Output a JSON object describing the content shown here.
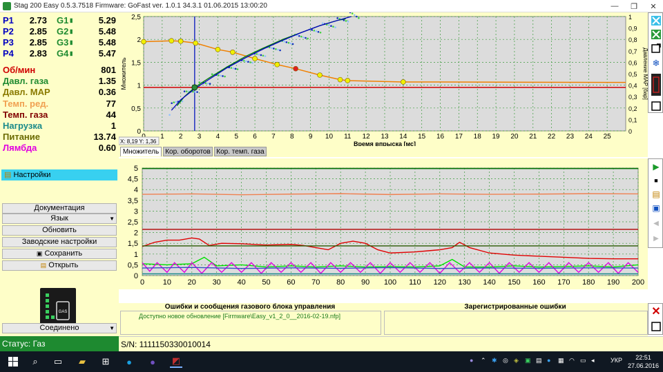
{
  "window": {
    "title": "Stag 200 Easy 0.5.3.7518 Firmware: GoFast  ver. 1.0.1  34.3.1  01.06.2015 13:00:20",
    "minimize": "—",
    "restore": "❐",
    "close": "✕"
  },
  "params": {
    "pressures": [
      {
        "p_label": "P1",
        "p_value": "2.73",
        "g_label": "G1",
        "g_value": "5.29"
      },
      {
        "p_label": "P2",
        "p_value": "2.85",
        "g_label": "G2",
        "g_value": "5.48"
      },
      {
        "p_label": "P3",
        "p_value": "2.85",
        "g_label": "G3",
        "g_value": "5.48"
      },
      {
        "p_label": "P4",
        "p_value": "2.83",
        "g_label": "G4",
        "g_value": "5.47"
      }
    ],
    "readings": [
      {
        "label": "Об/мин",
        "value": "801",
        "color": "#d00000"
      },
      {
        "label": "Давл. газа",
        "value": "1.35",
        "color": "#1e8a30"
      },
      {
        "label": "Давл. MAP",
        "value": "0.36",
        "color": "#8a7a00"
      },
      {
        "label": "Темп. ред.",
        "value": "77",
        "color": "#f0a050"
      },
      {
        "label": "Темп. газа",
        "value": "44",
        "color": "#800000"
      },
      {
        "label": "Нагрузка",
        "value": "1",
        "color": "#1a8a8a"
      },
      {
        "label": "Питание",
        "value": "13.74",
        "color": "#6a6a00"
      },
      {
        "label": "Лямбда",
        "value": "0.60",
        "color": "#e000e0"
      }
    ]
  },
  "settings": {
    "header": "Настройки",
    "buttons": {
      "docs": "Документация",
      "language": "Язык",
      "update": "Обновить",
      "factory": "Заводские настройки",
      "save": "Сохранить",
      "open": "Открыть",
      "connected": "Соединено"
    }
  },
  "gas_icon_label": "GAS",
  "status": {
    "left": "Статус: Газ",
    "serial": "S/N: 1111150330010014"
  },
  "chart1": {
    "ylabel_left": "Множитель",
    "ylabel_right": "Давление MAP [бар]",
    "xlabel": "Время впрыска [мс]",
    "cursor_readout": "X: 8,19  Y: 1,36"
  },
  "tabs": [
    "Множитель",
    "Кор. оборотов",
    "Кор. темп. газа"
  ],
  "errors": {
    "left_header": "Ошибки и сообщения газового блока управления",
    "right_header": "Зарегистрированные ошибки",
    "message": "Доступно новое обновление [Firmware\\Easy_v1_2_0__2016-02-19.nfp]"
  },
  "taskbar": {
    "lang": "УКР",
    "time": "22:51",
    "date": "27.06.2016"
  },
  "chart_data": [
    {
      "type": "line",
      "title": "",
      "xlabel": "Время впрыска [мс]",
      "ylabel": "Множитель",
      "y2label": "Давление MAP [бар]",
      "xlim": [
        0,
        26
      ],
      "ylim": [
        0,
        2.5
      ],
      "y2lim": [
        0,
        1.0
      ],
      "xticks": [
        0,
        1,
        2,
        3,
        4,
        5,
        6,
        7,
        8,
        9,
        10,
        11,
        12,
        13,
        14,
        15,
        16,
        17,
        18,
        19,
        20,
        21,
        22,
        23,
        24,
        25
      ],
      "yticks": [
        0,
        0.5,
        1,
        1.5,
        2,
        2.5
      ],
      "y2ticks": [
        0,
        0.1,
        0.2,
        0.3,
        0.4,
        0.5,
        0.6,
        0.7,
        0.8,
        0.9,
        1
      ],
      "grid": true,
      "cursor_x": 2.75,
      "reference_y": 0.95,
      "series": [
        {
          "color": "#f08000",
          "axis": "left",
          "x": [
            0,
            1.5,
            2,
            2.8,
            4,
            4.8,
            6,
            7.2,
            8.2,
            9.5,
            10.6,
            11,
            14,
            26
          ],
          "y": [
            1.95,
            1.97,
            1.96,
            1.92,
            1.78,
            1.72,
            1.58,
            1.45,
            1.36,
            1.22,
            1.12,
            1.1,
            1.07,
            1.06
          ]
        },
        {
          "color": "#008000",
          "axis": "left",
          "x": [
            1.8,
            2.2,
            2.75,
            3.5,
            4.5,
            5.5,
            6.5,
            7.5,
            8.5,
            9.5,
            10.5,
            10.9
          ],
          "y": [
            0.55,
            0.75,
            0.95,
            1.15,
            1.4,
            1.63,
            1.82,
            2.0,
            2.15,
            2.3,
            2.42,
            2.45
          ]
        },
        {
          "color": "#0000c0",
          "axis": "left",
          "x": [
            1.5,
            2.0,
            2.75,
            3.5,
            4.5,
            5.5,
            6.5,
            7.5,
            8.5,
            9.5,
            10.5,
            11.2
          ],
          "y": [
            0.45,
            0.68,
            0.92,
            1.12,
            1.38,
            1.6,
            1.8,
            1.98,
            2.15,
            2.3,
            2.42,
            2.5
          ]
        }
      ]
    },
    {
      "type": "line",
      "title": "",
      "xlabel": "",
      "ylabel": "",
      "xlim": [
        0,
        200
      ],
      "ylim": [
        0,
        5
      ],
      "xticks": [
        0,
        10,
        20,
        30,
        40,
        50,
        60,
        70,
        80,
        90,
        100,
        110,
        120,
        130,
        140,
        150,
        160,
        170,
        180,
        190,
        200
      ],
      "yticks": [
        0,
        0.5,
        1,
        1.5,
        2,
        2.5,
        3,
        3.5,
        4,
        4.5,
        5
      ],
      "grid": true,
      "series": [
        {
          "color": "#007000",
          "x": [
            0,
            200
          ],
          "y": [
            4.98,
            4.98
          ]
        },
        {
          "color": "#f08050",
          "x": [
            0,
            20,
            40,
            60,
            80,
            100,
            120,
            140,
            160,
            180,
            200
          ],
          "y": [
            3.78,
            3.8,
            3.76,
            3.79,
            3.81,
            3.77,
            3.8,
            3.78,
            3.79,
            3.81,
            3.8
          ]
        },
        {
          "color": "#b00000",
          "x": [
            0,
            200
          ],
          "y": [
            2.15,
            2.15
          ]
        },
        {
          "color": "#e00000",
          "x": [
            0,
            5,
            10,
            15,
            20,
            23,
            27,
            32,
            40,
            50,
            60,
            65,
            75,
            80,
            85,
            90,
            95,
            100,
            110,
            115,
            120,
            125,
            128,
            132,
            140,
            150,
            160,
            170,
            180,
            190,
            200
          ],
          "y": [
            1.35,
            1.55,
            1.65,
            1.65,
            1.75,
            1.7,
            1.4,
            1.5,
            1.48,
            1.42,
            1.45,
            1.4,
            1.2,
            1.5,
            1.6,
            1.5,
            1.2,
            1.05,
            1.1,
            1.15,
            1.2,
            1.3,
            1.55,
            1.3,
            1.05,
            0.95,
            0.9,
            0.85,
            0.8,
            0.78,
            0.78
          ]
        },
        {
          "color": "#2a5a00",
          "x": [
            0,
            200
          ],
          "y": [
            1.38,
            1.38
          ]
        },
        {
          "color": "#00e000",
          "x": [
            0,
            10,
            20,
            25,
            30,
            40,
            50,
            60,
            70,
            80,
            90,
            100,
            110,
            120,
            125,
            130,
            140,
            150,
            160,
            170,
            180,
            190,
            200
          ],
          "y": [
            0.55,
            0.5,
            0.55,
            0.85,
            0.45,
            0.5,
            0.4,
            0.45,
            0.4,
            0.45,
            0.4,
            0.42,
            0.4,
            0.45,
            0.75,
            0.4,
            0.4,
            0.45,
            0.4,
            0.42,
            0.45,
            0.4,
            0.5
          ]
        },
        {
          "color": "#e000e0",
          "x": [
            0,
            3,
            6,
            10,
            13,
            17,
            20,
            24,
            28,
            32,
            36,
            40,
            44,
            48,
            52,
            56,
            60,
            64,
            68,
            72,
            76,
            80,
            84,
            88,
            92,
            96,
            100,
            104,
            108,
            112,
            116,
            120,
            124,
            128,
            132,
            136,
            140,
            144,
            148,
            152,
            156,
            160,
            164,
            168,
            172,
            176,
            180,
            184,
            188,
            192,
            196,
            200
          ],
          "y": [
            0.6,
            0.2,
            0.6,
            0.15,
            0.6,
            0.15,
            0.6,
            0.1,
            0.6,
            0.15,
            0.6,
            0.15,
            0.6,
            0.1,
            0.6,
            0.15,
            0.6,
            0.15,
            0.6,
            0.1,
            0.6,
            0.15,
            0.6,
            0.15,
            0.6,
            0.1,
            0.6,
            0.15,
            0.6,
            0.15,
            0.6,
            0.1,
            0.6,
            0.15,
            0.6,
            0.15,
            0.6,
            0.1,
            0.6,
            0.15,
            0.6,
            0.15,
            0.6,
            0.1,
            0.6,
            0.15,
            0.6,
            0.15,
            0.6,
            0.1,
            0.6,
            0.15
          ]
        },
        {
          "color": "#3050c0",
          "x": [
            0,
            20,
            40,
            60,
            80,
            100,
            120,
            140,
            160,
            180,
            200
          ],
          "y": [
            0.35,
            0.38,
            0.33,
            0.36,
            0.34,
            0.37,
            0.33,
            0.35,
            0.34,
            0.36,
            0.35
          ]
        },
        {
          "color": "#1a8a8a",
          "x": [
            0,
            200
          ],
          "y": [
            0.08,
            0.08
          ]
        }
      ]
    }
  ]
}
